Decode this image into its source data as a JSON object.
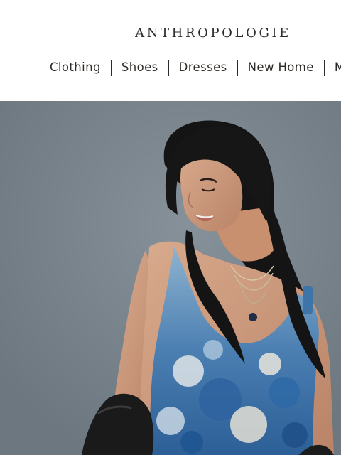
{
  "brand": {
    "name": "ANTHROPOLOGIE"
  },
  "nav": {
    "items": [
      {
        "label": "Clothing"
      },
      {
        "label": "Shoes"
      },
      {
        "label": "Dresses"
      },
      {
        "label": "New Home"
      },
      {
        "label": "M"
      }
    ]
  },
  "hero": {
    "image": "model-in-blue-floral-dress",
    "background_color": "#78838b"
  }
}
